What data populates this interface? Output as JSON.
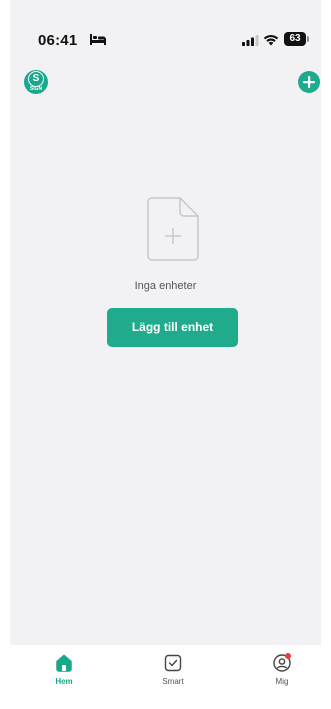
{
  "status_bar": {
    "time": "06:41",
    "battery_level": "63",
    "icons": [
      "bed-icon",
      "signal-icon",
      "wifi-icon",
      "battery-icon"
    ]
  },
  "header": {
    "sign_badge": {
      "letter": "S",
      "label": "SIGN",
      "icon": "sign-icon"
    },
    "add_icon": "plus-icon"
  },
  "empty_state": {
    "icon": "empty-document-plus-icon",
    "message": "Inga enheter",
    "button_label": "Lägg till enhet"
  },
  "tab_bar": {
    "tabs": [
      {
        "label": "Hem",
        "icon": "home-icon",
        "active": true
      },
      {
        "label": "Smart",
        "icon": "checkbox-icon",
        "active": false
      },
      {
        "label": "Mig",
        "icon": "profile-icon",
        "active": false,
        "has_notification": true
      }
    ]
  },
  "colors": {
    "accent": "#20ab8c",
    "background": "#f2f2f4",
    "notification": "#ee3b3b"
  }
}
